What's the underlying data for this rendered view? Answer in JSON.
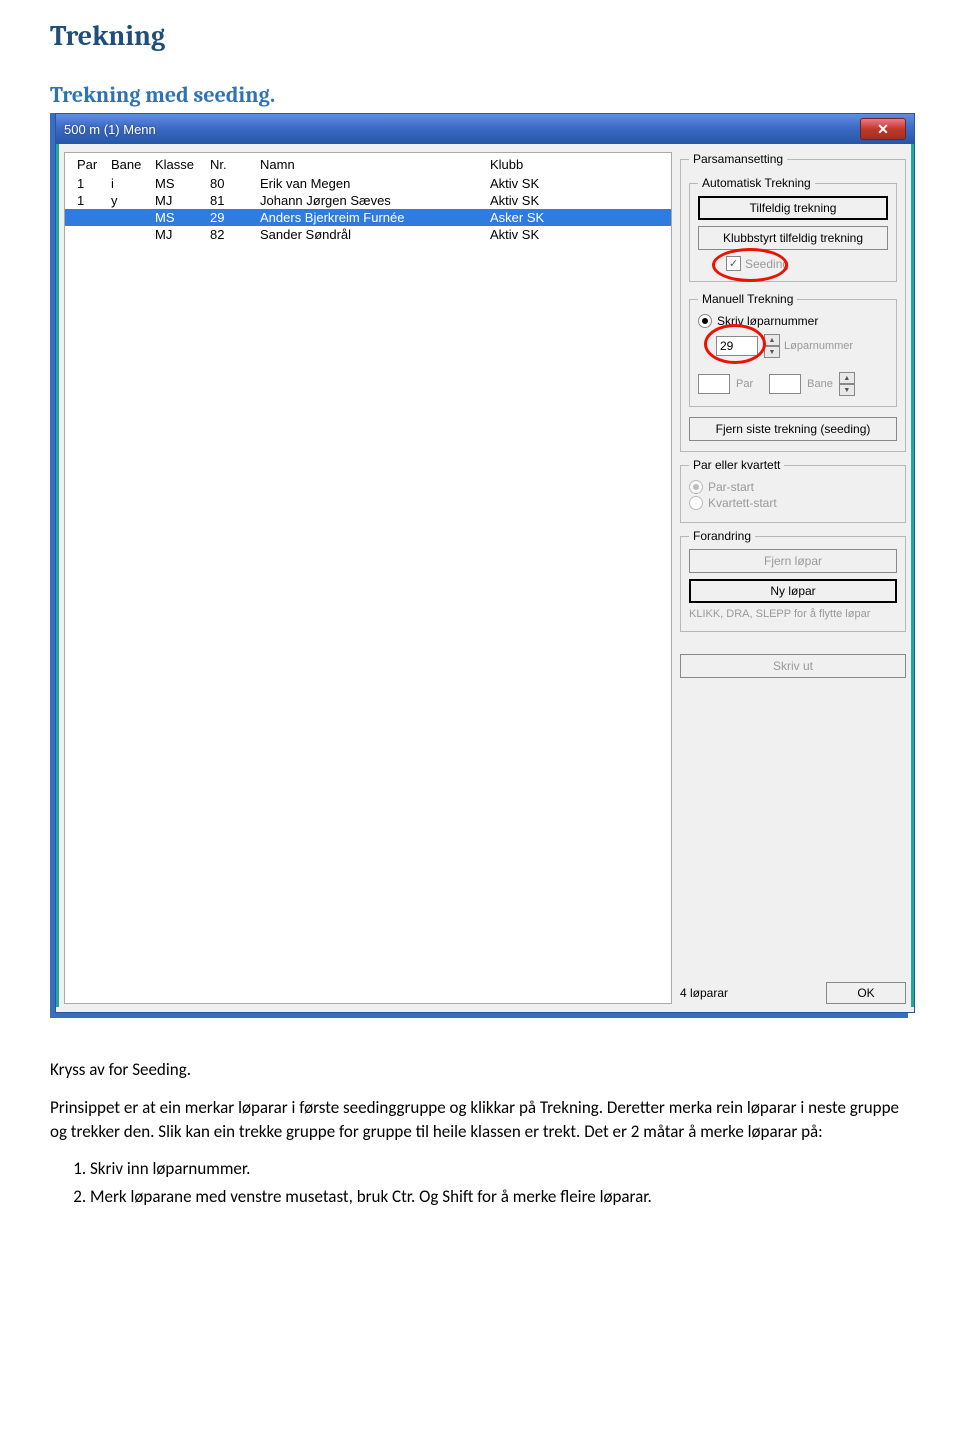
{
  "doc": {
    "h1": "Trekning",
    "h2": "Trekning med seeding.",
    "p1": "Kryss av for Seeding.",
    "p2": "Prinsippet er at ein merkar løparar i første seedinggruppe og klikkar på Trekning. Deretter merka rein løparar i neste gruppe og trekker den. Slik kan ein trekke gruppe for gruppe til heile klassen er trekt. Det er 2 måtar å merke løparar på:",
    "li1": "Skriv inn løparnummer.",
    "li2": "Merk løparane med venstre musetast, bruk Ctr. Og Shift for å merke fleire løparar."
  },
  "window": {
    "title": "500 m (1) Menn",
    "headers": {
      "par": "Par",
      "bane": "Bane",
      "klasse": "Klasse",
      "nr": "Nr.",
      "namn": "Namn",
      "klubb": "Klubb"
    },
    "rows": [
      {
        "par": "1",
        "bane": "i",
        "klasse": "MS",
        "nr": "80",
        "namn": "Erik van Megen",
        "klubb": "Aktiv SK",
        "sel": false
      },
      {
        "par": "1",
        "bane": "y",
        "klasse": "MJ",
        "nr": "81",
        "namn": "Johann Jørgen Sæves",
        "klubb": "Aktiv SK",
        "sel": false
      },
      {
        "par": "",
        "bane": "",
        "klasse": "MS",
        "nr": "29",
        "namn": "Anders Bjerkreim Furnée",
        "klubb": "Asker SK",
        "sel": true
      },
      {
        "par": "",
        "bane": "",
        "klasse": "MJ",
        "nr": "82",
        "namn": "Sander Søndrål",
        "klubb": "Aktiv SK",
        "sel": false
      }
    ],
    "groups": {
      "parsamansetting": "Parsamansetting",
      "auto": "Automatisk Trekning",
      "manuell": "Manuell Trekning",
      "parkvartett": "Par eller kvartett",
      "forandring": "Forandring"
    },
    "buttons": {
      "tilfeldig": "Tilfeldig trekning",
      "klubbstyrt": "Klubbstyrt tilfeldig trekning",
      "fjernSiste": "Fjern siste trekning (seeding)",
      "fjernLopar": "Fjern løpar",
      "nyLopar": "Ny løpar",
      "skrivUt": "Skriv ut",
      "ok": "OK"
    },
    "labels": {
      "seeding": "Seeding",
      "skrivLoparnummer": "Skriv løparnummer",
      "loparnummer": "Løparnummer",
      "par": "Par",
      "bane": "Bane",
      "parStart": "Par-start",
      "kvartettStart": "Kvartett-start",
      "hint": "KLIKK, DRA, SLEPP for å flytte løpar",
      "count": "4 løparar"
    },
    "inputs": {
      "loparnummer": "29",
      "par": "",
      "bane": ""
    }
  }
}
